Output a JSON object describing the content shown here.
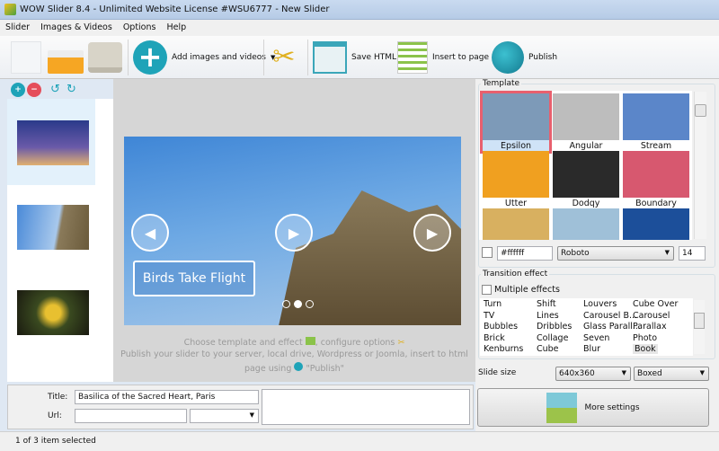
{
  "window": {
    "title": "WOW Slider 8.4 - Unlimited Website License #WSU6777 - New Slider"
  },
  "menu": [
    "Slider",
    "Images & Videos",
    "Options",
    "Help"
  ],
  "toolbar": {
    "add_images": "Add images and videos",
    "save_html": "Save HTML",
    "insert_page": "Insert to page",
    "publish": "Publish"
  },
  "slides": [
    {
      "title": "Basilica of the Sacred Heart, Paris",
      "selected": true
    },
    {
      "title": ""
    },
    {
      "title": ""
    }
  ],
  "preview": {
    "caption": "Birds Take Flight",
    "dots": 3,
    "active_dot": 1,
    "hint1": "Choose template and effect",
    "hint1b": ", configure options",
    "hint2": "Publish your slider to your server, local drive, Wordpress or Joomla, insert to html",
    "hint3a": "page using",
    "hint3b": "\"Publish\""
  },
  "template": {
    "label": "Template",
    "selected": "Epsilon",
    "items": [
      {
        "name": "Epsilon",
        "color": "#7d9ab8"
      },
      {
        "name": "Angular",
        "color": "#bdbdbd"
      },
      {
        "name": "Stream",
        "color": "#5b86c9"
      },
      {
        "name": "Utter",
        "color": "#f0a020"
      },
      {
        "name": "Dodqy",
        "color": "#2a2a2a"
      },
      {
        "name": "Boundary",
        "color": "#d7586f"
      },
      {
        "name": "",
        "color": "#d8b060"
      },
      {
        "name": "",
        "color": "#9fc0d8"
      },
      {
        "name": "",
        "color": "#1c4f9a"
      }
    ],
    "color_value": "#ffffff",
    "font": "Roboto",
    "font_size": "14"
  },
  "transition": {
    "label": "Transition effect",
    "multiple_label": "Multiple effects",
    "multiple_checked": false,
    "columns": [
      [
        "Turn",
        "TV",
        "Bubbles",
        "Brick",
        "Kenburns"
      ],
      [
        "Shift",
        "Lines",
        "Dribbles",
        "Collage",
        "Cube"
      ],
      [
        "Louvers",
        "Carousel B...",
        "Glass Parall...",
        "Seven",
        "Blur"
      ],
      [
        "Cube Over",
        "Carousel",
        "Parallax",
        "Photo",
        "Book"
      ]
    ],
    "selected": "Book"
  },
  "slide_size": {
    "label": "Slide size",
    "size": "640x360",
    "mode": "Boxed"
  },
  "more_settings": "More settings",
  "form": {
    "title_label": "Title:",
    "title_value": "Basilica of the Sacred Heart, Paris",
    "url_label": "Url:",
    "url_value": ""
  },
  "status": "1 of 3 item selected"
}
